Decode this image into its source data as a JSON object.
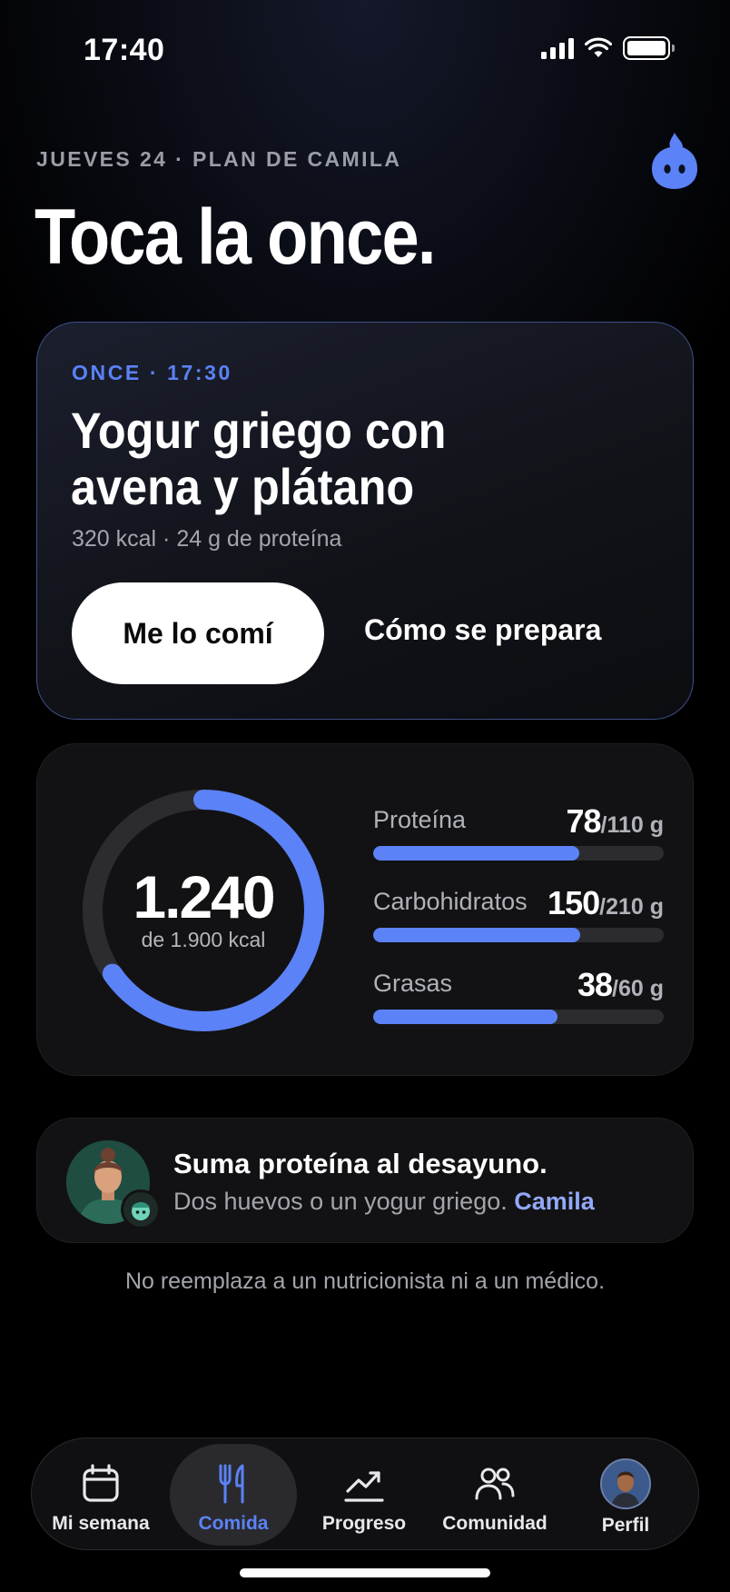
{
  "status_bar": {
    "time": "17:40"
  },
  "header": {
    "eyebrow": "JUEVES 24 · PLAN DE CAMILA",
    "title": "Toca la once."
  },
  "meal": {
    "eyebrow": "ONCE · 17:30",
    "title": "Yogur griego con avena y plátano",
    "meta": "320 kcal · 24 g de proteína",
    "primary_action": "Me lo comí",
    "secondary_action": "Cómo se prepara"
  },
  "calories": {
    "value": "1.240",
    "goal_label": "de 1.900 kcal",
    "progress": 0.653
  },
  "macros": [
    {
      "name": "Proteína",
      "value": "78",
      "goal": "/110 g",
      "progress": 0.709
    },
    {
      "name": "Carbohidratos",
      "value": "150",
      "goal": "/210 g",
      "progress": 0.714
    },
    {
      "name": "Grasas",
      "value": "38",
      "goal": "/60 g",
      "progress": 0.633
    }
  ],
  "tip": {
    "title": "Suma proteína al desayuno.",
    "body": "Dos huevos o un yogur griego.",
    "author": "Camila"
  },
  "disclaimer": "No reemplaza a un nutricionista ni a un médico.",
  "tabs": [
    {
      "label": "Mi semana",
      "icon": "calendar-icon",
      "active": false
    },
    {
      "label": "Comida",
      "icon": "fork-knife-icon",
      "active": true
    },
    {
      "label": "Progreso",
      "icon": "trend-chart-icon",
      "active": false
    },
    {
      "label": "Comunidad",
      "icon": "people-icon",
      "active": false
    },
    {
      "label": "Perfil",
      "icon": "profile-avatar",
      "active": false
    }
  ],
  "colors": {
    "accent": "#5B82F6",
    "link": "#93A8F7",
    "background": "#000000",
    "card": "#121214"
  }
}
